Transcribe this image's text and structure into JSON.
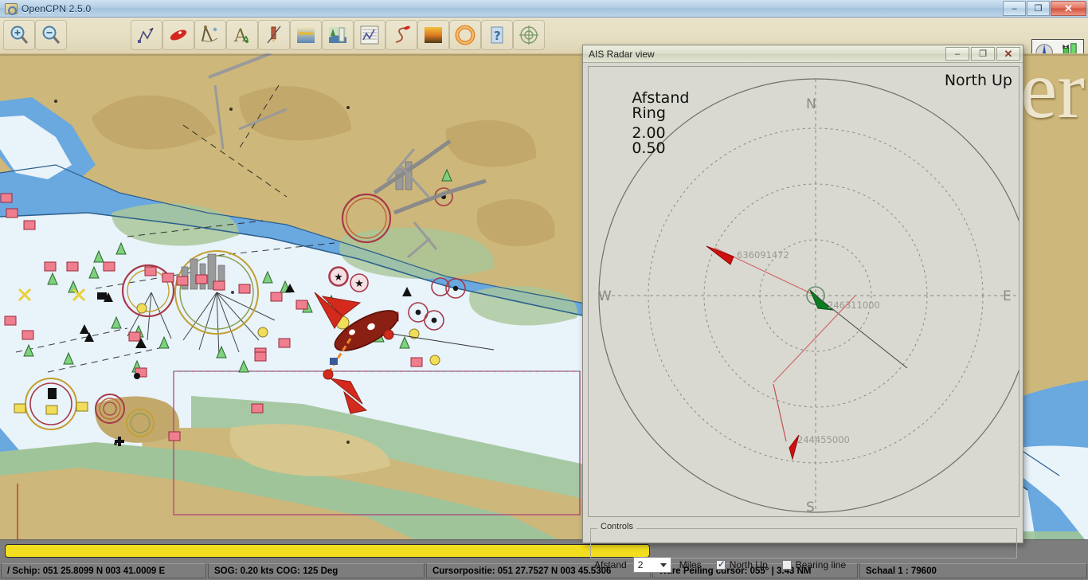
{
  "window": {
    "title": "OpenCPN 2.5.0",
    "app_icon": "opencpn-logo-icon",
    "buttons": {
      "minimize": "–",
      "maximize": "❐",
      "close": "✕"
    }
  },
  "toolbar": {
    "items": [
      {
        "name": "zoom-in-button",
        "icon": "magnifier-plus-icon"
      },
      {
        "name": "zoom-out-button",
        "icon": "magnifier-minus-icon"
      },
      {
        "name": "spacer-1",
        "icon": "blank-icon"
      },
      {
        "name": "spacer-2",
        "icon": "blank-icon"
      },
      {
        "name": "create-route-button",
        "icon": "route-polyline-icon"
      },
      {
        "name": "route-manager-button",
        "icon": "red-boat-icon"
      },
      {
        "name": "measure-button",
        "icon": "dividers-icon"
      },
      {
        "name": "text-label-button",
        "icon": "letter-a-icon"
      },
      {
        "name": "mark-button",
        "icon": "pencil-mark-icon"
      },
      {
        "name": "tide-button",
        "icon": "tide-arrows-icon"
      },
      {
        "name": "current-button",
        "icon": "current-bottle-icon"
      },
      {
        "name": "chart-table-button",
        "icon": "chart-table-icon"
      },
      {
        "name": "track-button",
        "icon": "track-s-curve-icon"
      },
      {
        "name": "sunset-button",
        "icon": "sunset-icon"
      },
      {
        "name": "ais-button",
        "icon": "lifebuoy-icon"
      },
      {
        "name": "help-button",
        "icon": "question-mark-icon"
      },
      {
        "name": "follow-ship-button",
        "icon": "crosshair-target-icon"
      }
    ],
    "gps_widget": {
      "name": "gps-compass-signal-widget",
      "compass": "compass-needle-icon",
      "bars": "signal-bars-icon"
    }
  },
  "chart": {
    "watermark_text": "er",
    "vessel_label": "own-ship-vector"
  },
  "radar": {
    "title": "AIS Radar view",
    "buttons": {
      "minimize": "–",
      "maximize": "❐",
      "close": "✕"
    },
    "range_label": "Afstand",
    "range_value": "2.00",
    "ring_label": "Ring",
    "ring_value": "0.50",
    "orientation": "North Up",
    "compass": {
      "n": "N",
      "e": "E",
      "s": "S",
      "w": "W"
    },
    "targets": [
      {
        "mmsi": "636091472",
        "color": "#cc0000",
        "kind": "ais-target-red"
      },
      {
        "mmsi": "246311000",
        "color": "#0a7d20",
        "kind": "ais-target-green"
      },
      {
        "mmsi": "244455000",
        "color": "#cc0000",
        "kind": "ais-target-red"
      }
    ],
    "controls": {
      "legend": "Controls",
      "distance_label": "Afstand",
      "distance_value": "2",
      "unit_label": "Miles",
      "north_up_label": "North Up",
      "north_up_checked": true,
      "bearing_line_label": "Bearing line",
      "bearing_line_checked": false
    }
  },
  "progress": {
    "name": "chart-load-progress",
    "percent": 100,
    "color": "#f2de1e"
  },
  "statusbar": {
    "ship": "/ Schip: 051 25.8099 N   003 41.0009 E",
    "sog_cog": "SOG:  0.20 kts  COG:   125 Deg",
    "cursor_position": "Cursorpositie: 051 27.7527 N 003 45.5306",
    "bearing": "Ware Peiling cursor: 055°  |    3.43 NM",
    "scale": "Schaal 1 :    79600"
  }
}
